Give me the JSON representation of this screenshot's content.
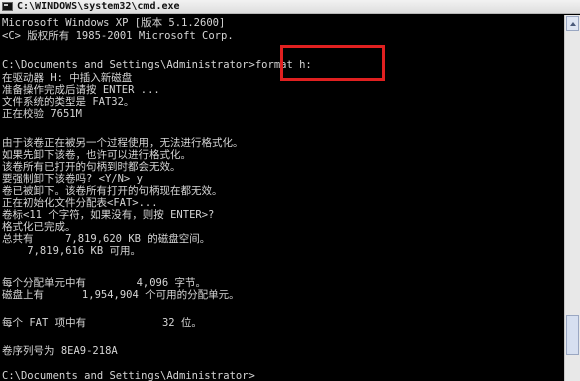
{
  "window": {
    "title": "C:\\WINDOWS\\system32\\cmd.exe"
  },
  "console": {
    "lines": [
      "Microsoft Windows XP [版本 5.1.2600]",
      "<C> 版权所有 1985-2001 Microsoft Corp.",
      "",
      "C:\\Documents and Settings\\Administrator>format h:",
      "在驱动器 H: 中插入新磁盘",
      "准备操作完成后请按 ENTER ...",
      "文件系统的类型是 FAT32。",
      "正在校验 7651M",
      "",
      "由于该卷正在被另一个过程使用，无法进行格式化。",
      "如果先卸下该卷，也许可以进行格式化。",
      "该卷所有已打开的句柄到时都会无效。",
      "要强制卸下该卷吗? <Y/N> y",
      "卷已被卸下。该卷所有打开的句柄现在都无效。",
      "正在初始化文件分配表<FAT>...",
      "卷标<11 个字符，如果没有，则按 ENTER>?",
      "格式化已完成。",
      "总共有     7,819,620 KB 的磁盘空间。",
      "    7,819,616 KB 可用。",
      "",
      "每个分配单元中有        4,096 字节。",
      "磁盘上有      1,954,904 个可用的分配单元。",
      "",
      "每个 FAT 项中有            32 位。",
      "",
      "卷序列号为 8EA9-218A",
      "",
      "C:\\Documents and Settings\\Administrator>_"
    ]
  }
}
